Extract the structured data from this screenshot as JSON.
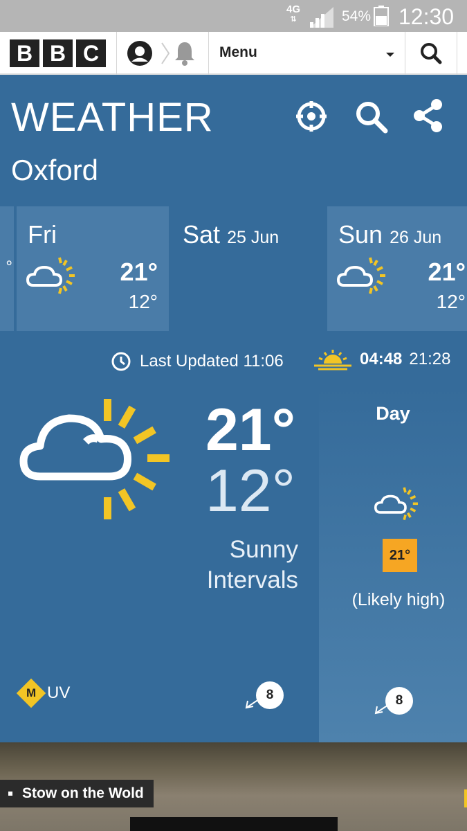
{
  "status_bar": {
    "network": "4G",
    "battery_percent": "54%",
    "time": "12:30"
  },
  "bbc_nav": {
    "logo_letters": [
      "B",
      "B",
      "C"
    ],
    "menu_label": "Menu"
  },
  "weather": {
    "title": "WEATHER",
    "location": "Oxford",
    "forecast_days": [
      {
        "day": "Fri",
        "date": "",
        "high": "21°",
        "low": "12°",
        "icon": "sunny-intervals-icon"
      },
      {
        "day": "Sat",
        "date": "25 Jun",
        "high": "",
        "low": "",
        "icon": ""
      },
      {
        "day": "Sun",
        "date": "26 Jun",
        "high": "21°",
        "low": "12°",
        "icon": "sunny-intervals-icon"
      }
    ],
    "last_updated": "Last Updated 11:06",
    "sunrise": "04:48",
    "sunset": "21:28",
    "today": {
      "high": "21°",
      "low": "12°",
      "description_line1": "Sunny",
      "description_line2": "Intervals",
      "uv_level": "M",
      "uv_label": "UV",
      "wind_speed": "8"
    },
    "day_panel": {
      "label": "Day",
      "temperature": "21°",
      "note": "(Likely high)",
      "wind_speed": "8"
    }
  },
  "map": {
    "location_label": "Stow on the Wold"
  },
  "colors": {
    "background": "#356b9a",
    "card_alt": "#4a7ca8",
    "sun_yellow": "#f2c525",
    "temp_badge": "#f6a623"
  }
}
